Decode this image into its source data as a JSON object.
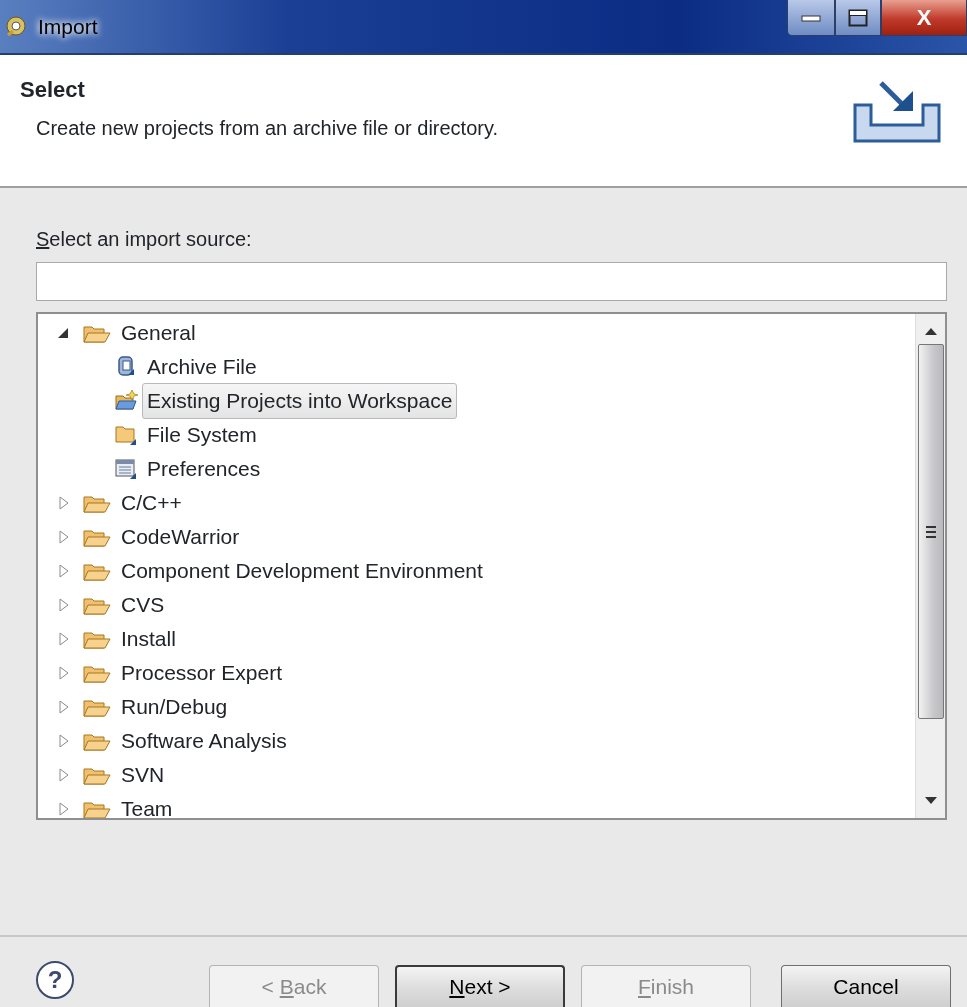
{
  "window": {
    "title": "Import",
    "controls": [
      {
        "kind": "minimize"
      },
      {
        "kind": "maximize"
      },
      {
        "kind": "close",
        "label": "X"
      }
    ]
  },
  "header": {
    "title": "Select",
    "description": "Create new projects from an archive file or directory."
  },
  "source_label": {
    "mnemonic": "S",
    "rest": "elect an import source:"
  },
  "tree": [
    {
      "label": "General",
      "expanded": true,
      "selected": false,
      "children": [
        {
          "label": "Archive File",
          "kind": "archive",
          "selected": false
        },
        {
          "label": "Existing Projects into Workspace",
          "kind": "project",
          "selected": true
        },
        {
          "label": "File System",
          "kind": "folder",
          "selected": false
        },
        {
          "label": "Preferences",
          "kind": "preferences",
          "selected": false
        }
      ]
    },
    {
      "label": "C/C++",
      "expanded": false,
      "selected": false
    },
    {
      "label": "CodeWarrior",
      "expanded": false,
      "selected": false
    },
    {
      "label": "Component Development Environment",
      "expanded": false,
      "selected": false
    },
    {
      "label": "CVS",
      "expanded": false,
      "selected": false
    },
    {
      "label": "Install",
      "expanded": false,
      "selected": false
    },
    {
      "label": "Processor Expert",
      "expanded": false,
      "selected": false
    },
    {
      "label": "Run/Debug",
      "expanded": false,
      "selected": false
    },
    {
      "label": "Software Analysis",
      "expanded": false,
      "selected": false
    },
    {
      "label": "SVN",
      "expanded": false,
      "selected": false
    },
    {
      "label": "Team",
      "expanded": false,
      "selected": false
    }
  ],
  "help_button": {
    "label": "?"
  },
  "buttons": [
    {
      "prefix": "< ",
      "mnemonic": "B",
      "rest": "ack",
      "disabled": true,
      "default": false
    },
    {
      "mnemonic": "N",
      "rest": "ext >",
      "disabled": false,
      "default": true
    },
    {
      "mnemonic": "F",
      "rest": "inish",
      "disabled": true,
      "default": false
    },
    {
      "rest": "Cancel",
      "disabled": false,
      "default": false
    }
  ]
}
